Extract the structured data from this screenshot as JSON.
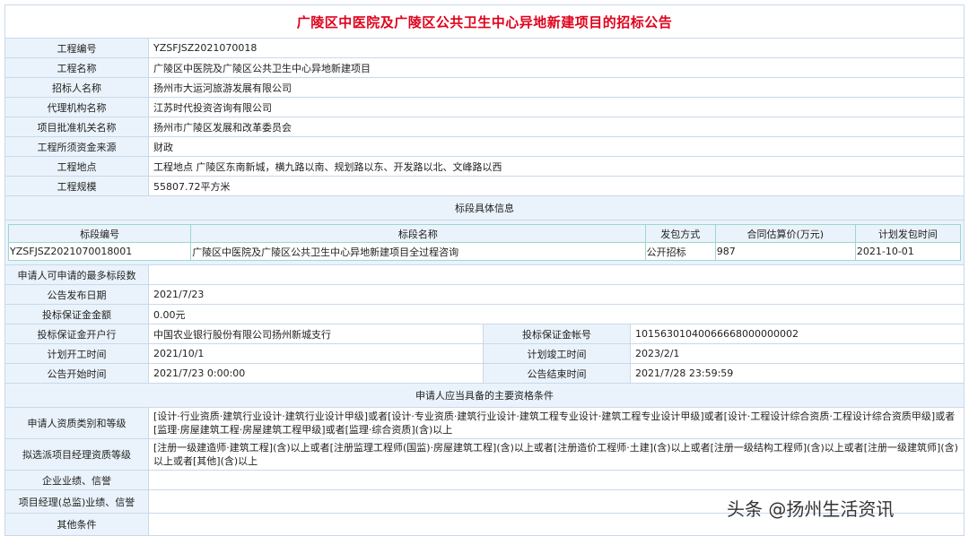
{
  "title": "广陵区中医院及广陵区公共卫生中心异地新建项目的招标公告",
  "project_info": [
    {
      "label": "工程编号",
      "value": "YZSFJSZ2021070018"
    },
    {
      "label": "工程名称",
      "value": "广陵区中医院及广陵区公共卫生中心异地新建项目"
    },
    {
      "label": "招标人名称",
      "value": "扬州市大运河旅游发展有限公司"
    },
    {
      "label": "代理机构名称",
      "value": "江苏时代投资咨询有限公司"
    },
    {
      "label": "项目批准机关名称",
      "value": "扬州市广陵区发展和改革委员会"
    },
    {
      "label": "工程所须资金来源",
      "value": "财政"
    },
    {
      "label": "工程地点",
      "value": "工程地点 广陵区东南新城，横九路以南、规划路以东、开发路以北、文峰路以西"
    },
    {
      "label": "工程规模",
      "value": "55807.72平方米"
    }
  ],
  "section_bid_info": "标段具体信息",
  "lot_table": {
    "headers": [
      "标段编号",
      "标段名称",
      "发包方式",
      "合同估算价(万元)",
      "计划发包时间"
    ],
    "rows": [
      [
        "YZSFJSZ2021070018001",
        "广陵区中医院及广陵区公共卫生中心异地新建项目全过程咨询",
        "公开招标",
        "987",
        "2021-10-01"
      ]
    ]
  },
  "bid_info": [
    {
      "label": "申请人可申请的最多标段数",
      "value": ""
    },
    {
      "label": "公告发布日期",
      "value": "2021/7/23"
    },
    {
      "label": "投标保证金金额",
      "value": "0.00元"
    }
  ],
  "bid_pairs": [
    {
      "l1": "投标保证金开户行",
      "v1": "中国农业银行股份有限公司扬州新城支行",
      "l2": "投标保证金帐号",
      "v2": "10156301040066668000000002"
    },
    {
      "l1": "计划开工时间",
      "v1": "2021/10/1",
      "l2": "计划竣工时间",
      "v2": "2023/2/1"
    },
    {
      "l1": "公告开始时间",
      "v1": "2021/7/23 0:00:00",
      "l2": "公告结束时间",
      "v2": "2021/7/28 23:59:59"
    }
  ],
  "section_qualifications": "申请人应当具备的主要资格条件",
  "qualifications": [
    {
      "label": "申请人资质类别和等级",
      "value": "[设计·行业资质·建筑行业设计·建筑行业设计甲级]或者[设计·专业资质·建筑行业设计·建筑工程专业设计·建筑工程专业设计甲级]或者[设计·工程设计综合资质·工程设计综合资质甲级]或者[监理·房屋建筑工程·房屋建筑工程甲级]或者[监理·综合资质](含)以上"
    },
    {
      "label": "拟选派项目经理资质等级",
      "value": "[注册一级建造师·建筑工程](含)以上或者[注册监理工程师(国监)·房屋建筑工程](含)以上或者[注册造价工程师·土建](含)以上或者[注册一级结构工程师](含)以上或者[注册一级建筑师](含)以上或者[其他](含)以上"
    },
    {
      "label": "企业业绩、信誉",
      "value": ""
    },
    {
      "label": "项目经理(总监)业绩、信誉",
      "value": ""
    },
    {
      "label": "其他条件",
      "value": ""
    }
  ],
  "watermark": "头条 @扬州生活资讯"
}
